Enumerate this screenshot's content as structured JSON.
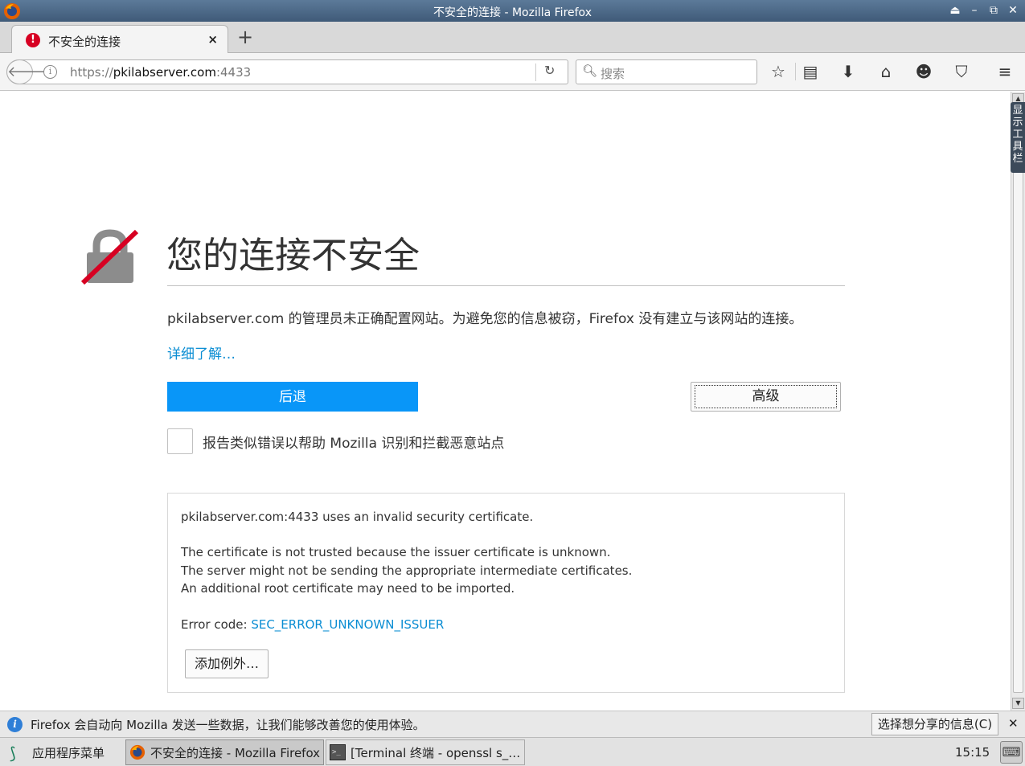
{
  "window": {
    "title": "不安全的连接 - Mozilla Firefox",
    "controls": [
      "⏏",
      "–",
      "⧉",
      "✕"
    ]
  },
  "tab": {
    "label": "不安全的连接",
    "close": "×",
    "new_tab": "+"
  },
  "navbar": {
    "url_scheme": "https://",
    "url_host": "pkilabserver.com",
    "url_port": ":4433",
    "search_placeholder": "搜索"
  },
  "side_toolbar": "显示工具栏",
  "page": {
    "title": "您的连接不安全",
    "description": "pkilabserver.com 的管理员未正确配置网站。为避免您的信息被窃，Firefox 没有建立与该网站的连接。",
    "learn_more": "详细了解…",
    "go_back": "后退",
    "advanced": "高级",
    "report_label": "报告类似错误以帮助 Mozilla 识别和拦截恶意站点",
    "details": {
      "line1": "pkilabserver.com:4433 uses an invalid security certificate.",
      "line2": "The certificate is not trusted because the issuer certificate is unknown.",
      "line3": "The server might not be sending the appropriate intermediate certificates.",
      "line4": "An additional root certificate may need to be imported.",
      "error_code_label": "Error code: ",
      "error_code": "SEC_ERROR_UNKNOWN_ISSUER",
      "add_exception": "添加例外…"
    }
  },
  "notification": {
    "text": "Firefox 会自动向 Mozilla 发送一些数据，让我们能够改善您的使用体验。",
    "button": "选择想分享的信息(C)",
    "close": "✕"
  },
  "taskbar": {
    "start_menu": "应用程序菜单",
    "tasks": [
      {
        "label": "不安全的连接 - Mozilla Firefox"
      },
      {
        "label": "[Terminal 终端 - openssl s_…"
      }
    ],
    "clock": "15:15"
  },
  "colors": {
    "accent": "#0996f8",
    "link": "#0a8dd3",
    "error_red": "#d70022"
  }
}
